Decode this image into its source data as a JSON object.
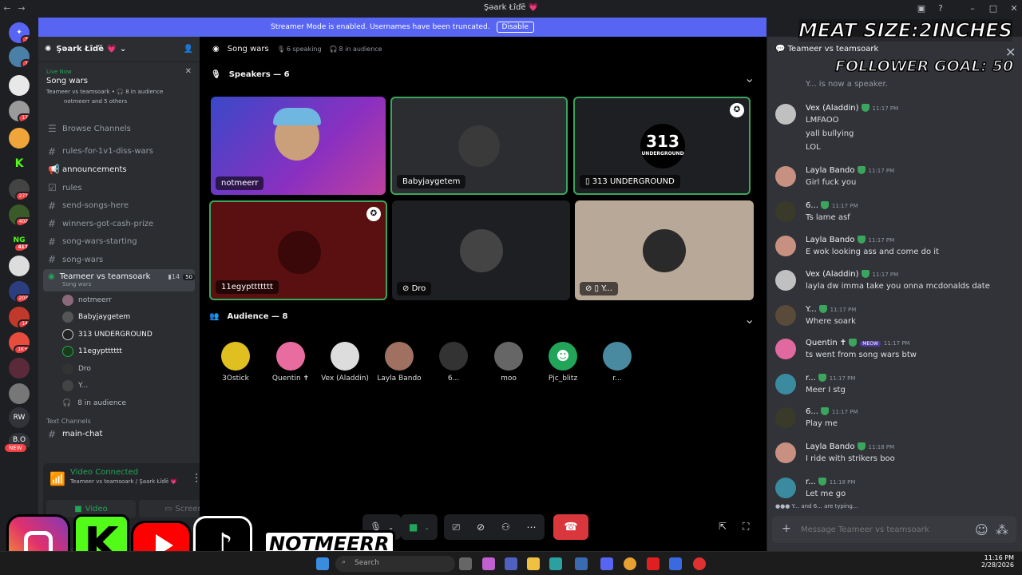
{
  "window": {
    "title": "Şəark Łîďē 💗"
  },
  "banner": {
    "text": "Streamer Mode is enabled. Usernames have been truncated.",
    "button": "Disable"
  },
  "rail": {
    "badges": [
      "3",
      "1",
      "17",
      "271",
      "402",
      "411",
      "203",
      "14",
      "1K+"
    ],
    "text_servers": [
      "RW",
      "B.O"
    ],
    "new_label": "NEW"
  },
  "server": {
    "name": "Şəark Łîďē 💗"
  },
  "live_card": {
    "live": "Live Now",
    "title": "Song wars",
    "sub1": "Teameer vs teamsoark • 🎧 8 in audience",
    "sub2": "notmeerr and 5 others"
  },
  "channels": {
    "browse": "Browse Channels",
    "list": [
      "rules-for-1v1-diss-wars",
      "announcements",
      "rules",
      "send-songs-here",
      "winners-got-cash-prize",
      "song-wars-starting",
      "song-wars"
    ],
    "active": {
      "name": "Teameer vs teamsoark",
      "sub": "Song wars",
      "count1": "14",
      "count2": "50"
    },
    "users": [
      "notmeerr",
      "Babyjaygetem",
      "313 UNDERGROUND",
      "11egyptttttt",
      "Dro",
      "Y..."
    ],
    "audience": "8 in audience",
    "section": "Text Channels",
    "main_chat": "main-chat"
  },
  "voice": {
    "status": "Video Connected",
    "location": "Teameer vs teamsoark / Şəark Łîďē 💗",
    "video": "Video",
    "screen": "Screen"
  },
  "stage": {
    "title": "Song wars",
    "speaking": "6 speaking",
    "audience": "8 in audience",
    "speakers_header": "Speakers — 6",
    "audience_header": "Audience — 8"
  },
  "speakers": [
    "notmeerr",
    "Babyjaygetem",
    "313 UNDERGROUND",
    "11egypttttttt",
    "Dro",
    "Y..."
  ],
  "audience": [
    "3Ostick",
    "Quentin ✝",
    "Vex (Aladdin)",
    "Layla Bando",
    "6...",
    "moo",
    "Pjc_blitz",
    "r..."
  ],
  "chat": {
    "channel": "Teameer vs teamsoark",
    "system": "Y... is now a speaker.",
    "messages": [
      {
        "user": "Vex (Aladdin)",
        "time": "11:17 PM",
        "lines": [
          "LMFAOO",
          "yall  bullying",
          "LOL"
        ]
      },
      {
        "user": "Layla Bando",
        "time": "11:17 PM",
        "lines": [
          "Girl fuck you"
        ]
      },
      {
        "user": "6...",
        "time": "11:17 PM",
        "lines": [
          "Ts lame asf"
        ]
      },
      {
        "user": "Layla Bando",
        "time": "11:17 PM",
        "lines": [
          "E wok looking ass and come do it"
        ]
      },
      {
        "user": "Vex (Aladdin)",
        "time": "11:17 PM",
        "lines": [
          "layla dw imma take you onna mcdonalds date"
        ]
      },
      {
        "user": "Y...",
        "time": "11:17 PM",
        "lines": [
          "Where soark"
        ]
      },
      {
        "user": "Quentin ✝",
        "time": "11:17 PM",
        "tag": "MEOW",
        "lines": [
          "ts went from song wars btw"
        ]
      },
      {
        "user": "r...",
        "time": "11:17 PM",
        "lines": [
          "Meer I stg"
        ]
      },
      {
        "user": "6...",
        "time": "11:17 PM",
        "lines": [
          "Play me"
        ]
      },
      {
        "user": "Layla Bando",
        "time": "11:18 PM",
        "lines": [
          "I ride with strikers boo"
        ]
      },
      {
        "user": "r...",
        "time": "11:18 PM",
        "lines": [
          "Let me go"
        ]
      }
    ],
    "typing": "Y... and 6... are typing...",
    "placeholder": "Message Teameer vs teamsoark"
  },
  "overlay": {
    "line1": "MEAT SIZE:2INCHES",
    "line2": "FOLLOWER GOAL: 50",
    "handle": "NOTMEERR",
    "k_letter": "K"
  },
  "taskbar": {
    "search": "Search",
    "time": "11:16 PM",
    "date": "2/28/2026"
  },
  "speaker_label_313": "313",
  "speaker_label_313_sub": "UNDERGROUND"
}
